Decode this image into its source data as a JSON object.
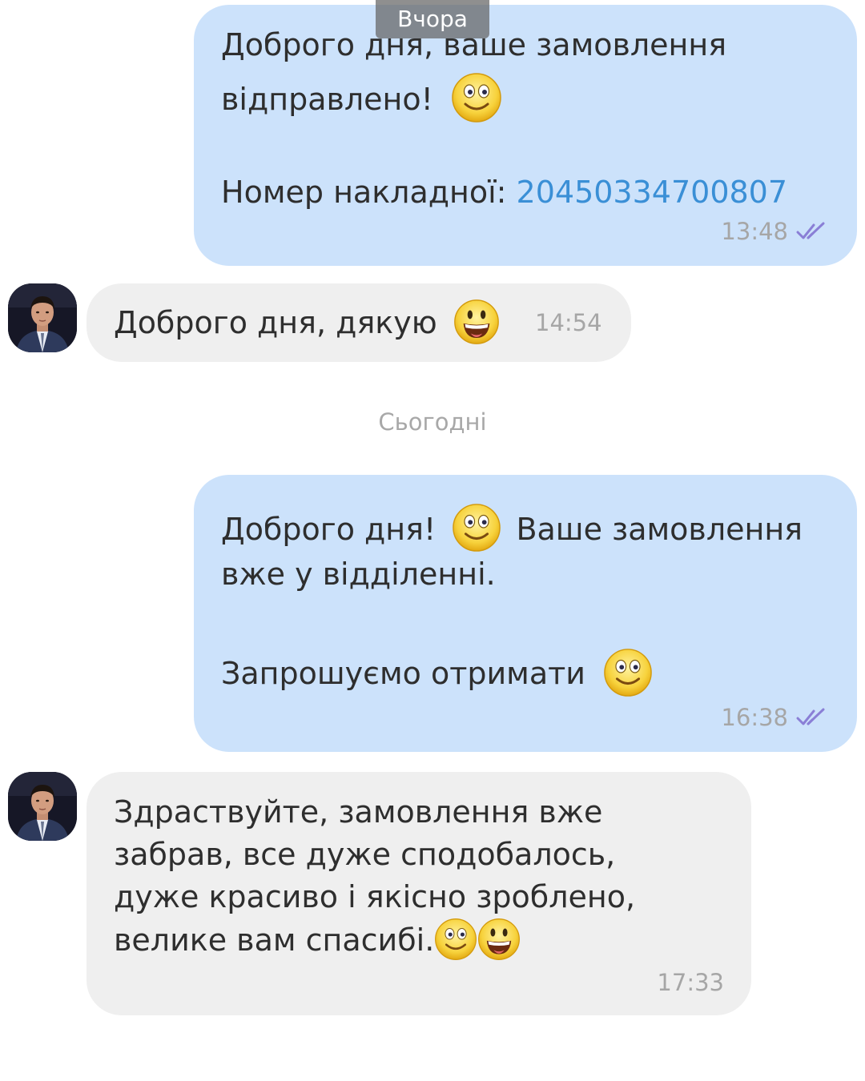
{
  "day_yesterday": "Вчора",
  "day_today": "Сьогодні",
  "messages": [
    {
      "line1": "Доброго дня, ваше замовлення",
      "line2": "відправлено!",
      "line3_label": "Номер накладної: ",
      "tracking_number": "20450334700807",
      "time": "13:48"
    },
    {
      "text": "Доброго дня, дякую",
      "time": "14:54"
    },
    {
      "line1_a": "Доброго дня!",
      "line1_b": "Ваше замовлення",
      "line2": "вже у відділенні.",
      "line3": "Запрошуємо отримати",
      "time": "16:38"
    },
    {
      "line1": "Здраствуйте, замовлення вже",
      "line2": "забрав, все дуже сподобалось,",
      "line3": "дуже красиво і якісно зроблено,",
      "line4": "велике вам спасибі.",
      "time": "17:33"
    }
  ],
  "colors": {
    "outgoing_bubble": "#cce2fb",
    "incoming_bubble": "#efefef",
    "link": "#3a8fd6",
    "read_ticks": "#8a7fd6"
  },
  "icons": [
    "smile-emoji-icon",
    "grin-emoji-icon",
    "double-check-icon"
  ]
}
